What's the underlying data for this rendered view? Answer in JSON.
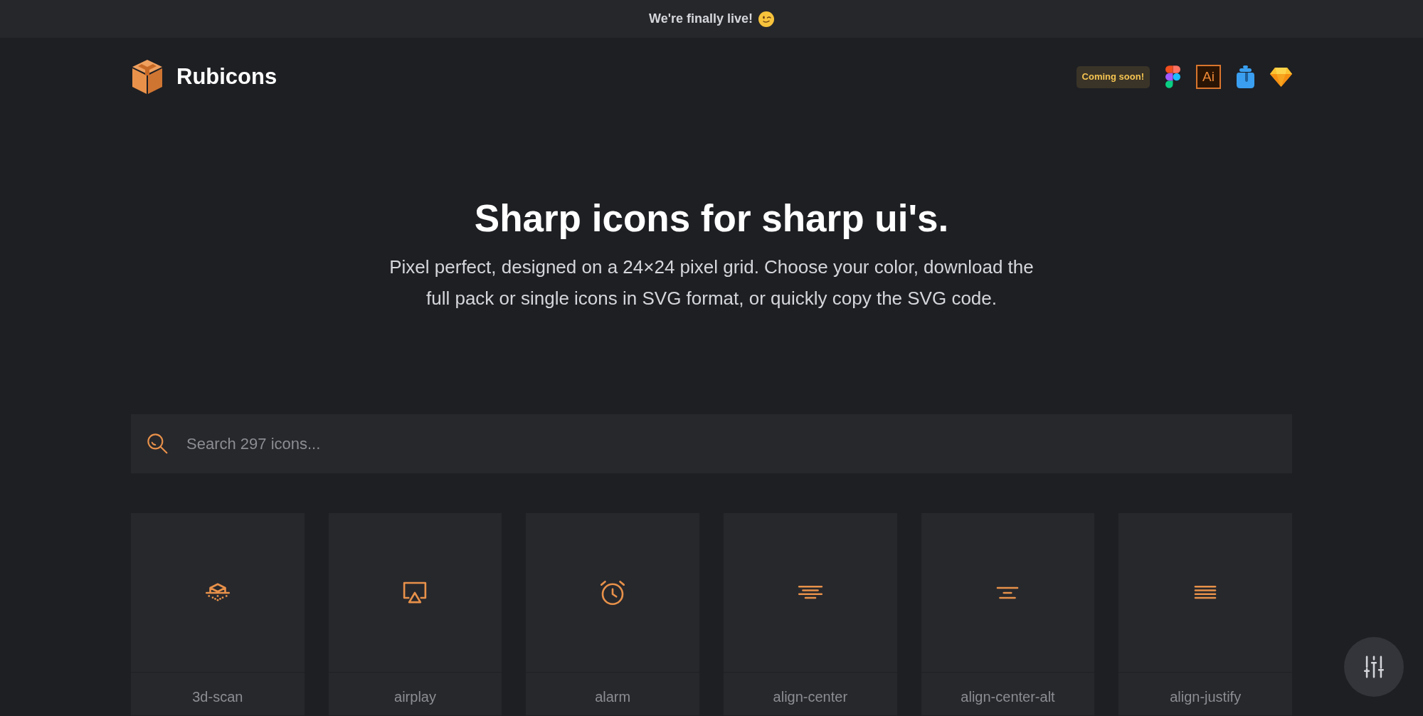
{
  "announcement": {
    "text": "We're finally live!"
  },
  "header": {
    "brand": "Rubicons",
    "badge": "Coming soon!",
    "ai_label": "Ai"
  },
  "hero": {
    "title": "Sharp icons for sharp ui's.",
    "subtitle": "Pixel perfect, designed on a 24×24 pixel grid. Choose your color, download the full pack or single icons in SVG format, or quickly copy the SVG code."
  },
  "search": {
    "placeholder": "Search 297 icons..."
  },
  "icons": [
    {
      "name": "3d-scan"
    },
    {
      "name": "airplay"
    },
    {
      "name": "alarm"
    },
    {
      "name": "align-center"
    },
    {
      "name": "align-center-alt"
    },
    {
      "name": "align-justify"
    }
  ]
}
